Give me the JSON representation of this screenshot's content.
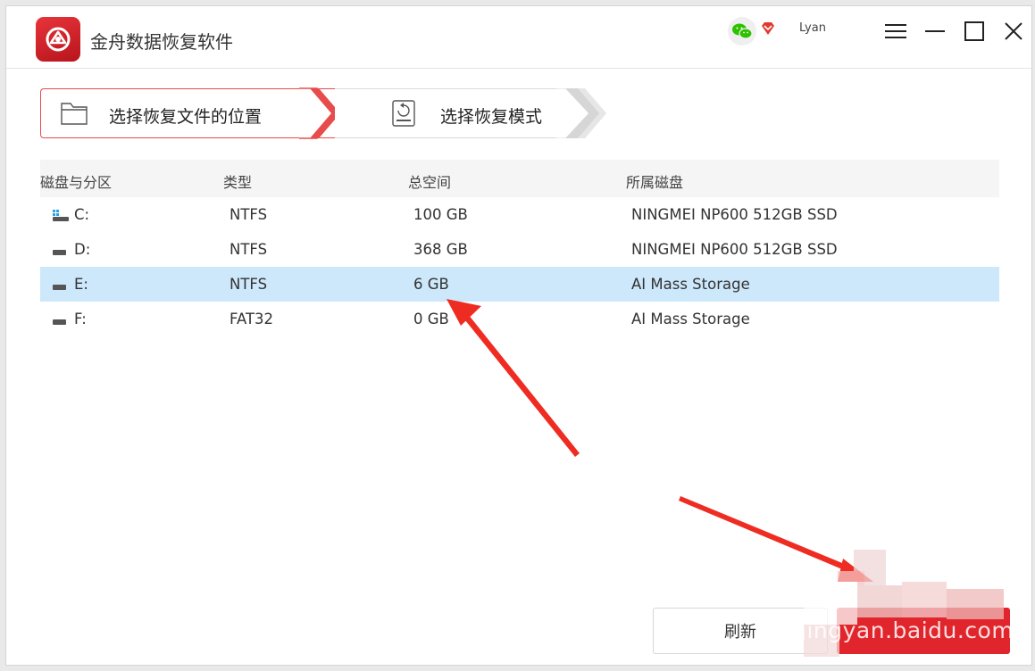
{
  "app": {
    "title": "金舟数据恢复软件",
    "username": "Lyan",
    "colors": {
      "brand": "#e0262c",
      "selected_row": "#cde8fb",
      "step_active": "#e84b4b"
    }
  },
  "titlebar": {
    "icons": [
      "wechat-icon",
      "gem-icon",
      "menu-icon",
      "minimize-icon",
      "maximize-icon",
      "close-icon"
    ]
  },
  "steps": [
    {
      "label": "选择恢复文件的位置",
      "active": true,
      "icon": "folder-icon"
    },
    {
      "label": "选择恢复模式",
      "active": false,
      "icon": "disk-icon"
    }
  ],
  "table": {
    "headers": {
      "name": "磁盘与分区",
      "type": "类型",
      "size": "总空间",
      "disk": "所属磁盘"
    },
    "rows": [
      {
        "name": "C:",
        "type": "NTFS",
        "size": "100 GB",
        "disk": "NINGMEI NP600 512GB SSD",
        "selected": false
      },
      {
        "name": "D:",
        "type": "NTFS",
        "size": "368 GB",
        "disk": "NINGMEI NP600 512GB SSD",
        "selected": false
      },
      {
        "name": "E:",
        "type": "NTFS",
        "size": "6 GB",
        "disk": "AI Mass Storage",
        "selected": true
      },
      {
        "name": "F:",
        "type": "FAT32",
        "size": "0 GB",
        "disk": "AI Mass Storage",
        "selected": false
      }
    ]
  },
  "footer": {
    "refresh_label": "刷新",
    "next_label": ""
  },
  "watermark": "jingyan.baidu.com"
}
